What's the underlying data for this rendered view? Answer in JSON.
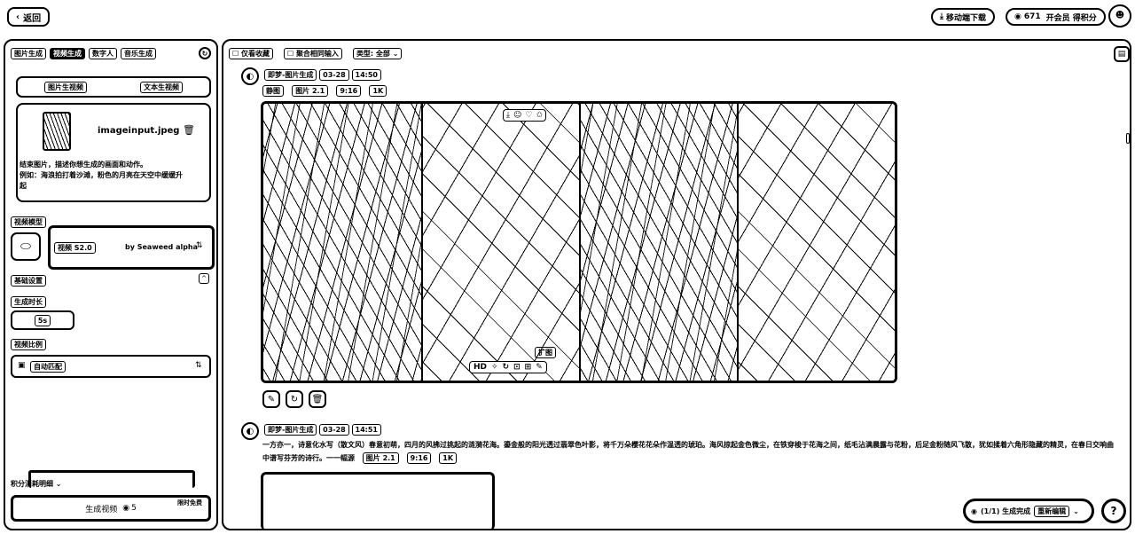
{
  "top_bar": {
    "back_label": "返回",
    "mobile_download": "移动端下载",
    "points": "671",
    "vip_label": "开会员 得积分"
  },
  "left_panel": {
    "tabs": [
      "图片生成",
      "视频生成",
      "数字人",
      "音乐生成"
    ],
    "sub_tabs": [
      "图片生视频",
      "文本生视频"
    ],
    "image_filename": "imageinput.jpeg",
    "prompt_line1": "结束图片，描述你想生成的画面和动作。",
    "prompt_line2": "例如：海浪拍打着沙滩，粉色的月亮在天空中缓缓升",
    "prompt_line3": "起",
    "model_section": "视频模型",
    "model_name": "视频 S2.0",
    "model_provider": "by Seaweed alpha",
    "basic_settings": "基础设置",
    "duration_label": "生成时长",
    "duration_value": "5s",
    "ratio_label": "视频比例",
    "ratio_value": "自动匹配",
    "points_detail": "积分消耗明细",
    "generate_label": "生成视频",
    "generate_cost": "5",
    "limited_free": "限时免费"
  },
  "main": {
    "filter_favorites": "仅看收藏",
    "filter_ref": "聚合相同输入",
    "type_filter": "类型: 全部",
    "entries": [
      {
        "title": "即梦-图片生成",
        "date": "03-28",
        "time": "14:50",
        "tags": [
          "静图",
          "图片 2.1",
          "9:16",
          "1K"
        ]
      },
      {
        "title": "即梦-图片生成",
        "date": "03-28",
        "time": "14:51",
        "prompt": "一方亦一，诗意化水写（散文风）春意初萌，四月的风拂过挑起的涟漪花海。鎏金般的阳光透过翡翠色叶影，将千万朵樱花花朵作温透的琥珀。海风掠起金色微尘，在铁穿梭于花海之间，纸毛沾满晨露与花粉，后足金粉随风飞散，犹如揉着六角形隐藏的精灵，在春日交响曲中谱写芬芳的诗行。一一幅源",
        "tags": [
          "图片 2.1",
          "9:16",
          "1K"
        ]
      }
    ],
    "expand_label": "扩图",
    "hd_label": "HD"
  },
  "bottom_right": {
    "progress": "(1/1) 生成完成",
    "action": "重新编辑"
  }
}
